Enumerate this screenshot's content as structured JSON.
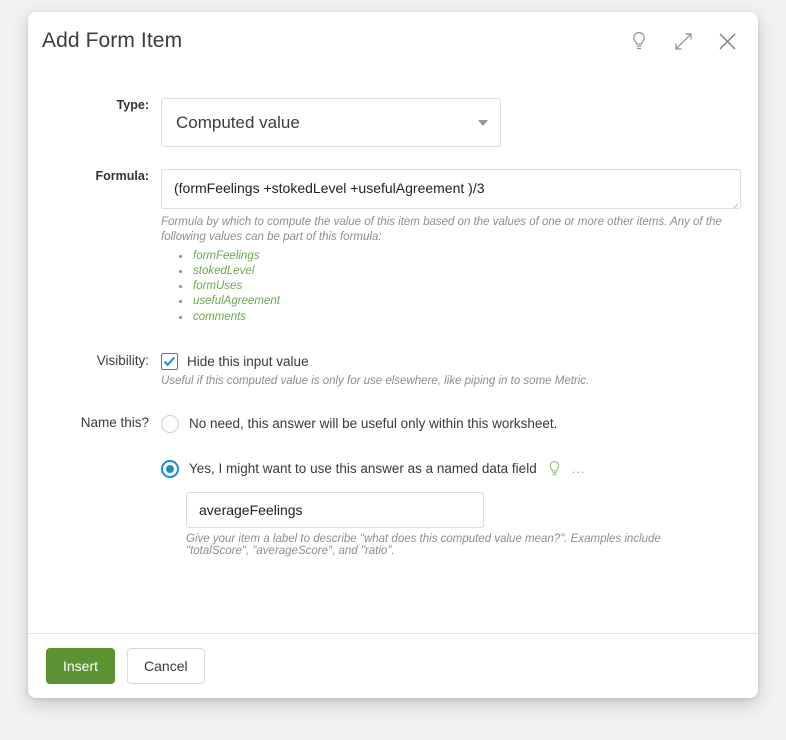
{
  "dialog": {
    "title": "Add Form Item",
    "header_icons": [
      {
        "name": "lightbulb-icon",
        "label": "Tips"
      },
      {
        "name": "expand-icon",
        "label": "Expand"
      },
      {
        "name": "close-icon",
        "label": "Close"
      }
    ]
  },
  "type_field": {
    "label": "Type:",
    "value": "Computed value",
    "caret": "chevron-down-icon"
  },
  "formula_field": {
    "label": "Formula:",
    "value": "(formFeelings +stokedLevel +usefulAgreement )/3",
    "hint": "Formula by which to compute the value of this item based on the values of one or more other items. Any of the following values can be part of this formula:",
    "variables": [
      "formFeelings",
      "stokedLevel",
      "formUses",
      "usefulAgreement",
      "comments"
    ]
  },
  "visibility_field": {
    "label": "Visibility:",
    "checkbox_label": "Hide this input value",
    "checked": true,
    "hint": "Useful if this computed value is only for use elsewhere, like piping in to some Metric."
  },
  "name_field": {
    "label": "Name this?",
    "option_no": "No need, this answer will be useful only within this worksheet.",
    "option_yes": "Yes, I might want to use this answer as a named data field",
    "yes_selected": true,
    "ellipsis": "...",
    "input_value": "averageFeelings",
    "hint": "Give your item a label to describe \"what does this computed value mean?\". Examples include \"totalScore\", \"averageScore\", and \"ratio\"."
  },
  "footer": {
    "insert_label": "Insert",
    "cancel_label": "Cancel"
  },
  "colors": {
    "primary_green": "#5b9234",
    "accent_blue": "#1a8cd8",
    "variable_green": "#6aa84f",
    "hint_gray": "#8d8d8d"
  }
}
